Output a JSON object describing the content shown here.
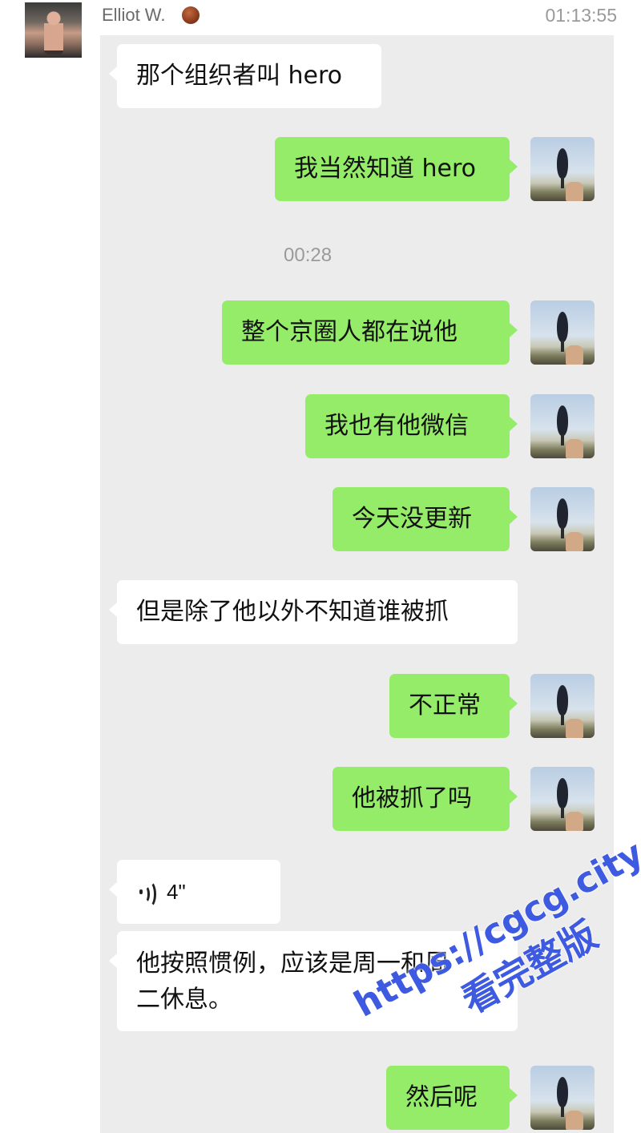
{
  "header": {
    "contact_name": "Elliot W.",
    "time": "01:13:55",
    "emoji_icon": "basketball-icon"
  },
  "timestamp": "00:28",
  "messages": [
    {
      "side": "left",
      "text": "那个组织者叫 hero"
    },
    {
      "side": "right",
      "text": "我当然知道 hero"
    },
    {
      "side": "right",
      "text": "整个京圈人都在说他"
    },
    {
      "side": "right",
      "text": "我也有他微信"
    },
    {
      "side": "right",
      "text": "今天没更新"
    },
    {
      "side": "left",
      "text": "但是除了他以外不知道谁被抓"
    },
    {
      "side": "right",
      "text": "不正常"
    },
    {
      "side": "right",
      "text": "他被抓了吗"
    },
    {
      "side": "left",
      "type": "voice",
      "duration": "4\""
    },
    {
      "side": "left",
      "text_line1": "他按照惯例，应该是周一和周",
      "text_line2": "二休息。"
    },
    {
      "side": "right",
      "text": "然后呢"
    }
  ],
  "watermark": {
    "url": "https://cgcg.city",
    "subtitle": "看完整版"
  },
  "colors": {
    "outgoing_bubble": "#95ec69",
    "incoming_bubble": "#ffffff",
    "chat_background": "#ececec",
    "watermark": "#3d5ae0"
  }
}
